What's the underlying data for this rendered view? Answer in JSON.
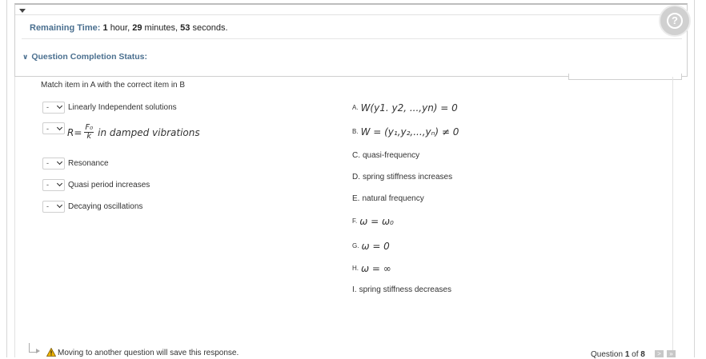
{
  "status_panel": {
    "remaining_label": "Remaining Time:",
    "hours": "1",
    "hours_unit": "hour,",
    "minutes": "29",
    "minutes_unit": "minutes,",
    "seconds": "53",
    "seconds_unit": "seconds.",
    "completion_label": "Question Completion Status:",
    "help_icon": "question-mark"
  },
  "question": {
    "instruction": "Match item in A with the correct item in B",
    "left_items": [
      {
        "selected": "-",
        "label": "Linearly Independent solutions"
      },
      {
        "selected": "-",
        "label_suffix": "in damped vibrations",
        "formula": {
          "lhs": "R",
          "eq": "=",
          "num": "F₀",
          "den": "k"
        }
      },
      {
        "selected": "-",
        "label": "Resonance"
      },
      {
        "selected": "-",
        "label": "Quasi period increases"
      },
      {
        "selected": "-",
        "label": "Decaying oscillations"
      }
    ],
    "right_items": [
      {
        "letter": "A.",
        "text": "W(y1. y2, ...,yn) = 0"
      },
      {
        "letter": "B.",
        "text": "W = (y₁,y₂,...,yₙ) ≠ 0"
      },
      {
        "letter": "C.",
        "text": "quasi-frequency"
      },
      {
        "letter": "D.",
        "text": "spring stiffness increases"
      },
      {
        "letter": "E.",
        "text": "natural frequency"
      },
      {
        "letter": "F.",
        "text": "ω = ω₀"
      },
      {
        "letter": "G.",
        "text": "ω = 0"
      },
      {
        "letter": "H.",
        "text": "ω = ∞"
      },
      {
        "letter": "I.",
        "text": "spring stiffness decreases"
      }
    ]
  },
  "footer": {
    "warning": "Moving to another question will save this response.",
    "counter_prefix": "Question",
    "current": "1",
    "counter_mid": "of",
    "total": "8",
    "next_icon": ">",
    "last_icon": "»"
  }
}
